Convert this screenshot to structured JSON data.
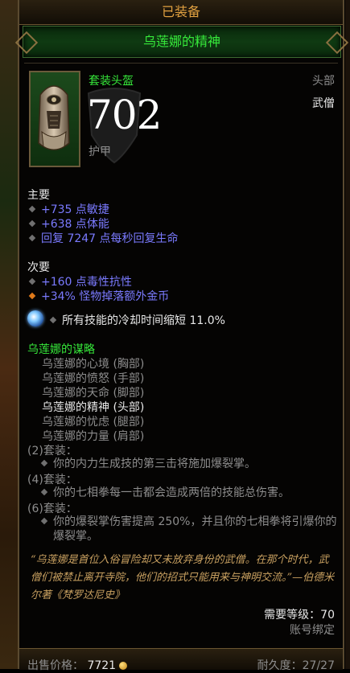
{
  "header": {
    "equipped": "已装备",
    "item_name": "乌莲娜的精神"
  },
  "item": {
    "set_type": "套装头盔",
    "slot": "头部",
    "class": "武僧",
    "armor_value": "702",
    "armor_label": "护甲",
    "icon": "helm-icon"
  },
  "primary": {
    "title": "主要",
    "stats": [
      "+735 点敏捷",
      "+638 点体能",
      "回复 7247 点每秒回复生命"
    ]
  },
  "secondary": {
    "title": "次要",
    "stats": [
      "+160 点毒性抗性",
      "+34% 怪物掉落额外金币"
    ]
  },
  "socket": {
    "gem_icon": "diamond-gem-icon",
    "text": "所有技能的冷却时间缩短 11.0%"
  },
  "set": {
    "title": "乌莲娜的谋略",
    "pieces": [
      {
        "name": "乌莲娜的心境 (胸部)",
        "active": false
      },
      {
        "name": "乌莲娜的愤怒 (手部)",
        "active": false
      },
      {
        "name": "乌莲娜的天命 (脚部)",
        "active": false
      },
      {
        "name": "乌莲娜的精神 (头部)",
        "active": true
      },
      {
        "name": "乌莲娜的忧虑 (腿部)",
        "active": false
      },
      {
        "name": "乌莲娜的力量 (肩部)",
        "active": false
      }
    ],
    "bonuses": [
      {
        "header": "(2)套装：",
        "text": "你的内力生成技的第三击将施加爆裂掌。"
      },
      {
        "header": "(4)套装：",
        "text": "你的七相拳每一击都会造成两倍的技能总伤害。"
      },
      {
        "header": "(6)套装：",
        "text": "你的爆裂掌伤害提高 250%，并且你的七相拳将引爆你的爆裂掌。"
      }
    ]
  },
  "flavor": "“乌莲娜是首位入俗冒险却又未放弃身份的武僧。在那个时代，武僧们被禁止离开寺院，他们的招式只能用来与神明交流。”—伯德米尔著《梵罗达尼史》",
  "requirements": {
    "level": "需要等级：70",
    "bound": "账号绑定"
  },
  "footer": {
    "sell_label": "出售价格：",
    "sell_value": "7721",
    "durability": "耐久度：27/27"
  },
  "colors": {
    "set_green": "#36e83a",
    "magic_blue": "#7a7aff",
    "gold": "#e0a040",
    "grey": "#8d8d8d"
  }
}
